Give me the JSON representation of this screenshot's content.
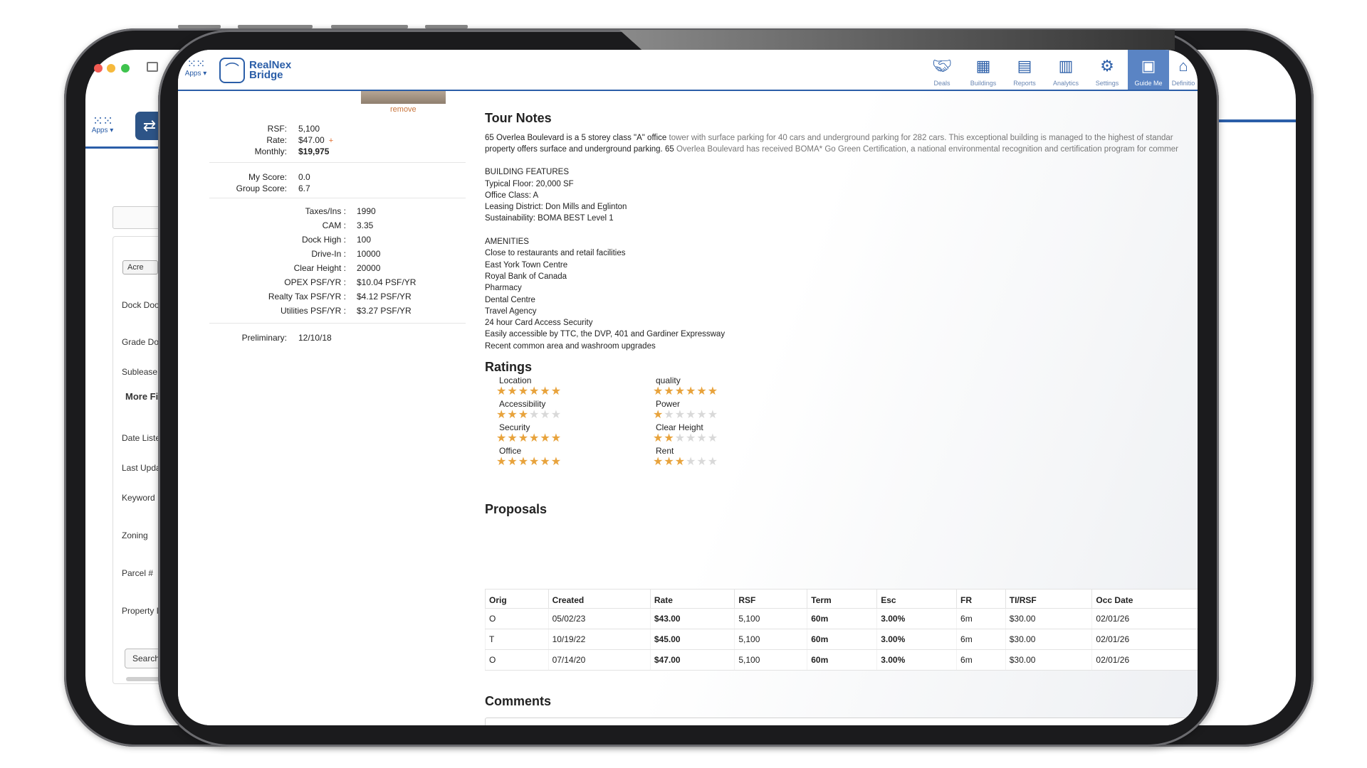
{
  "back_window": {
    "apps_label": "Apps",
    "select_value": "Acre",
    "labels": [
      "Dock Doo",
      "Grade Doo",
      "Sublease",
      "More Fie",
      "Date Liste",
      "Last Upda",
      "Keyword",
      "Zoning",
      "Parcel #",
      "Property I"
    ],
    "search_label": "Search"
  },
  "header": {
    "apps_label": "Apps",
    "logo_line1": "RealNex",
    "logo_line2": "Bridge",
    "nav": [
      {
        "label": "Deals",
        "icon": "handshake-icon"
      },
      {
        "label": "Buildings",
        "icon": "building-icon"
      },
      {
        "label": "Reports",
        "icon": "report-icon"
      },
      {
        "label": "Analytics",
        "icon": "analytics-icon"
      },
      {
        "label": "Settings",
        "icon": "gear-icon"
      },
      {
        "label": "Guide Me",
        "icon": "guide-icon",
        "active": true
      },
      {
        "label": "Definitio",
        "icon": "definition-icon"
      }
    ]
  },
  "property": {
    "remove_label": "remove",
    "rsf_label": "RSF:",
    "rsf": "5,100",
    "rate_label": "Rate:",
    "rate": "$47.00",
    "rate_add": "+",
    "monthly_label": "Monthly:",
    "monthly": "$19,975",
    "my_score_label": "My Score:",
    "my_score": "0.0",
    "group_score_label": "Group Score:",
    "group_score": "6.7",
    "details": [
      {
        "label": "Taxes/Ins :",
        "value": "1990"
      },
      {
        "label": "CAM :",
        "value": "3.35"
      },
      {
        "label": "Dock High :",
        "value": "100"
      },
      {
        "label": "Drive-In :",
        "value": "10000"
      },
      {
        "label": "Clear Height :",
        "value": "20000"
      },
      {
        "label": "OPEX PSF/YR :",
        "value": "$10.04 PSF/YR"
      },
      {
        "label": "Realty Tax PSF/YR :",
        "value": "$4.12 PSF/YR"
      },
      {
        "label": "Utilities PSF/YR :",
        "value": "$3.27 PSF/YR"
      }
    ],
    "preliminary_label": "Preliminary:",
    "preliminary": "12/10/18"
  },
  "tour_notes": {
    "title": "Tour Notes",
    "line1a": " 65 Overlea Boulevard is a 5 storey class \"A\" office ",
    "line1b": "tower with surface parking for 40 cars and underground parking for 282 cars. This exceptional building is managed to the highest of standar",
    "line2a": "property offers surface and underground parking. 65 ",
    "line2b": "Overlea Boulevard has received BOMA* Go Green Certification, a national environmental recognition and certification program for commer",
    "body": "\nBUILDING FEATURES\nTypical Floor: 20,000 SF\nOffice Class: A\nLeasing District: Don Mills and Eglinton\nSustainability: BOMA BEST Level 1\n\nAMENITIES\nClose to restaurants and retail facilities\nEast York Town Centre\nRoyal Bank of Canada\nPharmacy\nDental Centre\nTravel Agency\n24 hour Card Access Security\nEasily accessible by TTC, the DVP, 401 and Gardiner Expressway\nRecent common area and washroom upgrades"
  },
  "ratings": {
    "title": "Ratings",
    "max": 6,
    "items": [
      {
        "name": "Location",
        "score": 6
      },
      {
        "name": "quality",
        "score": 6
      },
      {
        "name": "Accessibility",
        "score": 3
      },
      {
        "name": "Power",
        "score": 1
      },
      {
        "name": "Security",
        "score": 6
      },
      {
        "name": "Clear Height",
        "score": 2
      },
      {
        "name": "Office",
        "score": 6
      },
      {
        "name": "Rent",
        "score": 3
      }
    ]
  },
  "proposals": {
    "title": "Proposals",
    "columns": [
      "Orig",
      "Created",
      "Rate",
      "RSF",
      "Term",
      "Esc",
      "FR",
      "TI/RSF",
      "Occ Date"
    ],
    "rows": [
      [
        "O",
        "05/02/23",
        "$43.00",
        "5,100",
        "60m",
        "3.00%",
        "6m",
        "$30.00",
        "02/01/26"
      ],
      [
        "T",
        "10/19/22",
        "$45.00",
        "5,100",
        "60m",
        "3.00%",
        "6m",
        "$30.00",
        "02/01/26"
      ],
      [
        "O",
        "07/14/20",
        "$47.00",
        "5,100",
        "60m",
        "3.00%",
        "6m",
        "$30.00",
        "02/01/26"
      ]
    ]
  },
  "comments": {
    "title": "Comments",
    "value": ""
  },
  "colors": {
    "accent": "#2b5ea8",
    "star": "#e8a33c",
    "remove": "#c8743b"
  }
}
